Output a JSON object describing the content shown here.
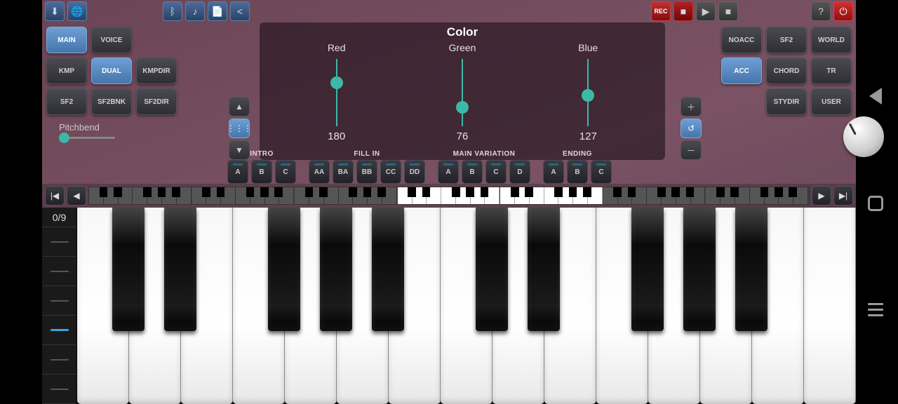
{
  "top": {
    "rec": "REC"
  },
  "left_buttons": [
    {
      "l": "MAIN",
      "a": true
    },
    {
      "l": "VOICE"
    },
    {
      "l": ""
    },
    {
      "l": "KMP"
    },
    {
      "l": "DUAL",
      "a": true
    },
    {
      "l": "KMPDIR"
    },
    {
      "l": "SF2"
    },
    {
      "l": "SF2BNK"
    },
    {
      "l": "SF2DIR"
    }
  ],
  "right_buttons": [
    {
      "l": "NOACC"
    },
    {
      "l": "SF2"
    },
    {
      "l": "WORLD"
    },
    {
      "l": "ACC",
      "a": true
    },
    {
      "l": "CHORD"
    },
    {
      "l": "TR"
    },
    {
      "l": ""
    },
    {
      "l": "STYDIR"
    },
    {
      "l": "USER"
    }
  ],
  "pitchbend_label": "Pitchbend",
  "color": {
    "title": "Color",
    "sliders": [
      {
        "label": "Red",
        "value": 180,
        "max": 255
      },
      {
        "label": "Green",
        "value": 76,
        "max": 255
      },
      {
        "label": "Blue",
        "value": 127,
        "max": 255
      }
    ]
  },
  "seq": [
    {
      "label": "INTRO",
      "btns": [
        "A",
        "B",
        "C"
      ]
    },
    {
      "label": "FILL IN",
      "btns": [
        "AA",
        "BA",
        "BB",
        "CC",
        "DD"
      ]
    },
    {
      "label": "MAIN VARIATION",
      "btns": [
        "A",
        "B",
        "C",
        "D"
      ]
    },
    {
      "label": "ENDING",
      "btns": [
        "A",
        "B",
        "C"
      ]
    }
  ],
  "zoom": "0/9",
  "white_key_count": 15,
  "mini_octaves": 7,
  "mini_selected": [
    3,
    4
  ]
}
